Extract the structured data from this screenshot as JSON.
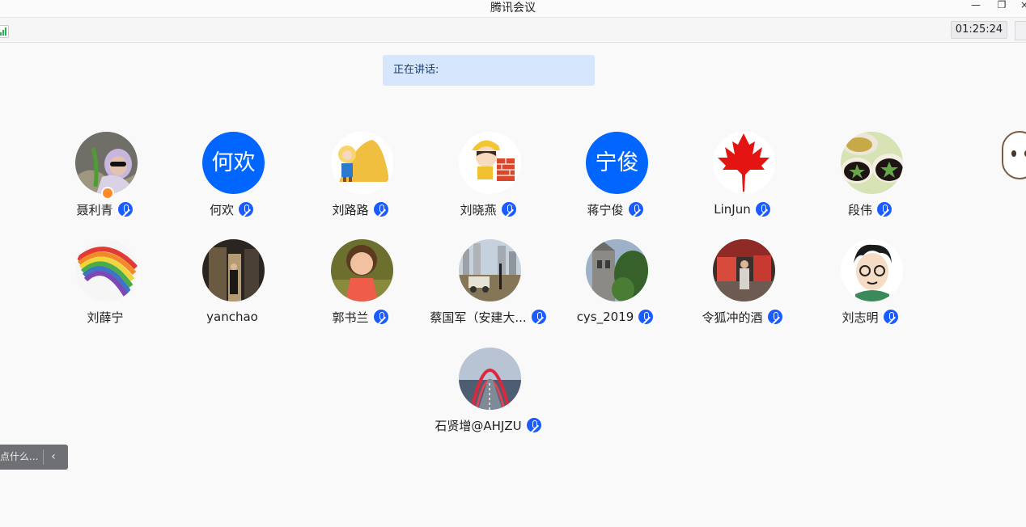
{
  "window": {
    "title": "腾讯会议"
  },
  "toolbar": {
    "timer": "01:25:24"
  },
  "speaking": {
    "label": "正在讲话:"
  },
  "participants": [
    {
      "name": "聂利青",
      "avatar": "photo",
      "host": true,
      "mic": false
    },
    {
      "name": "何欢",
      "avatar_text": "何欢",
      "mic": true
    },
    {
      "name": "刘路路",
      "avatar": "cartoon",
      "mic": true
    },
    {
      "name": "刘晓燕",
      "avatar": "cartoon",
      "mic": true
    },
    {
      "name": "蒋宁俊",
      "avatar_text": "宁俊",
      "mic": true
    },
    {
      "name": "LinJun",
      "avatar": "maple-leaf",
      "mic": true
    },
    {
      "name": "段伟",
      "avatar": "photo",
      "mic": true
    },
    {
      "name": "刘薛宁",
      "avatar": "rainbow",
      "mic": false
    },
    {
      "name": "yanchao",
      "avatar": "photo",
      "mic": false
    },
    {
      "name": "郭书兰",
      "avatar": "cartoon",
      "mic": true
    },
    {
      "name": "蔡国军（安建大...",
      "avatar": "photo",
      "mic": true
    },
    {
      "name": "cys_2019",
      "avatar": "photo",
      "mic": true
    },
    {
      "name": "令狐冲的酒",
      "avatar": "photo",
      "mic": true
    },
    {
      "name": "刘志明",
      "avatar": "cartoon",
      "mic": true
    },
    {
      "name": "石贤增@AHJZU",
      "avatar": "photo",
      "mic": true
    }
  ],
  "chat": {
    "placeholder": "点什么...",
    "collapse_icon": "‹"
  },
  "colors": {
    "accent": "#0066ff",
    "mic": "#1a5cff",
    "speaking_bg": "#d6e7fd"
  }
}
